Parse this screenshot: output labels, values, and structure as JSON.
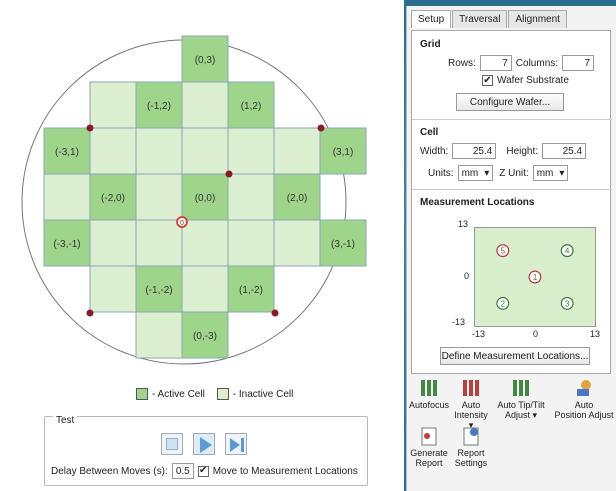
{
  "wafer": {
    "cells": [
      {
        "label": "(0,3)",
        "active": true,
        "col": 3,
        "row": 0
      },
      {
        "label": "(-1,2)",
        "active": true,
        "col": 2,
        "row": 1
      },
      {
        "label": "(1,2)",
        "active": true,
        "col": 4,
        "row": 1
      },
      {
        "label": "(-3,1)",
        "active": true,
        "col": 0,
        "row": 2
      },
      {
        "label": "(3,1)",
        "active": true,
        "col": 6,
        "row": 2
      },
      {
        "label": "(-2,0)",
        "active": true,
        "col": 1,
        "row": 3
      },
      {
        "label": "(0,0)",
        "active": true,
        "col": 3,
        "row": 3
      },
      {
        "label": "(2,0)",
        "active": true,
        "col": 5,
        "row": 3
      },
      {
        "label": "(-3,-1)",
        "active": true,
        "col": 0,
        "row": 4
      },
      {
        "label": "(3,-1)",
        "active": true,
        "col": 6,
        "row": 4
      },
      {
        "label": "(-1,-2)",
        "active": true,
        "col": 2,
        "row": 5
      },
      {
        "label": "(1,-2)",
        "active": true,
        "col": 4,
        "row": 5
      },
      {
        "label": "(0,-3)",
        "active": true,
        "col": 3,
        "row": 6
      }
    ],
    "origin_marker": "0"
  },
  "legend": {
    "active": "- Active Cell",
    "inactive": "- Inactive Cell"
  },
  "test": {
    "title": "Test",
    "delay_label": "Delay Between Moves (s):",
    "delay_value": "0.5",
    "move_label": "Move to Measurement Locations",
    "move_checked": true
  },
  "tabs": [
    "Setup",
    "Traversal",
    "Alignment"
  ],
  "grid": {
    "title": "Grid",
    "rows_label": "Rows:",
    "rows_value": "7",
    "cols_label": "Columns:",
    "cols_value": "7",
    "substrate_label": "Wafer Substrate",
    "configure_label": "Configure Wafer..."
  },
  "cell": {
    "title": "Cell",
    "width_label": "Width:",
    "width_value": "25.4",
    "height_label": "Height:",
    "height_value": "25.4",
    "units_label": "Units:",
    "units_value": "mm",
    "zunit_label": "Z Unit:",
    "zunit_value": "mm"
  },
  "measurement": {
    "title": "Measurement Locations",
    "y_top": "13",
    "y_mid": "0",
    "y_bot": "-13",
    "x_left": "-13",
    "x_mid": "0",
    "x_right": "13",
    "points": [
      {
        "n": "5",
        "x": -7,
        "y": 7,
        "color": "#b23b3b"
      },
      {
        "n": "4",
        "x": 7,
        "y": 7,
        "color": "#3a7a3a"
      },
      {
        "n": "1",
        "x": 0,
        "y": 0,
        "color": "#b23b3b"
      },
      {
        "n": "2",
        "x": -7,
        "y": -7,
        "color": "#3a7a3a"
      },
      {
        "n": "3",
        "x": 7,
        "y": -7,
        "color": "#3a7a3a"
      }
    ],
    "define_label": "Define Measurement Locations..."
  },
  "tools": {
    "autofocus": "Autofocus",
    "auto_intensity_1": "Auto",
    "auto_intensity_2": "Intensity ▾",
    "auto_tip_1": "Auto Tip/Tilt",
    "auto_tip_2": "Adjust ▾",
    "auto_pos_1": "Auto",
    "auto_pos_2": "Position Adjust",
    "generate_1": "Generate",
    "generate_2": "Report",
    "report_1": "Report",
    "report_2": "Settings"
  },
  "colors": {
    "active": "#9fd58a",
    "inactive": "#dcefd0",
    "grid_line": "#8aa7b8",
    "marker": "#8a1a2a"
  }
}
